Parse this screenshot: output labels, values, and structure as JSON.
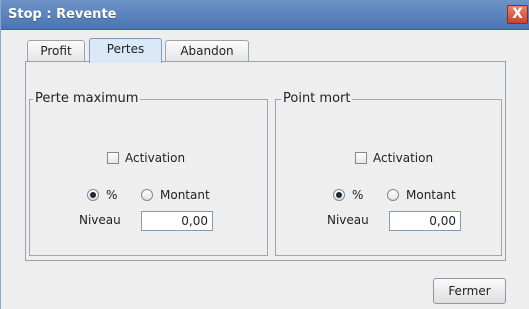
{
  "window": {
    "title": "Stop : Revente",
    "close_glyph": "X"
  },
  "tabs": [
    {
      "label": "Profit",
      "active": false
    },
    {
      "label": "Pertes",
      "active": true
    },
    {
      "label": "Abandon",
      "active": false
    }
  ],
  "groups": [
    {
      "title": "Perte maximum",
      "activation_label": "Activation",
      "activation_checked": false,
      "radio_percent_label": "%",
      "radio_amount_label": "Montant",
      "selected_mode": "%",
      "level_label": "Niveau",
      "level_value": "0,00"
    },
    {
      "title": "Point mort",
      "activation_label": "Activation",
      "activation_checked": false,
      "radio_percent_label": "%",
      "radio_amount_label": "Montant",
      "selected_mode": "%",
      "level_label": "Niveau",
      "level_value": "0,00"
    }
  ],
  "footer": {
    "close_label": "Fermer"
  },
  "colors": {
    "titlebar": "#5a84bd",
    "close_button": "#d45a44",
    "active_tab": "#dbe8f6",
    "field_border": "#7f9db9"
  }
}
